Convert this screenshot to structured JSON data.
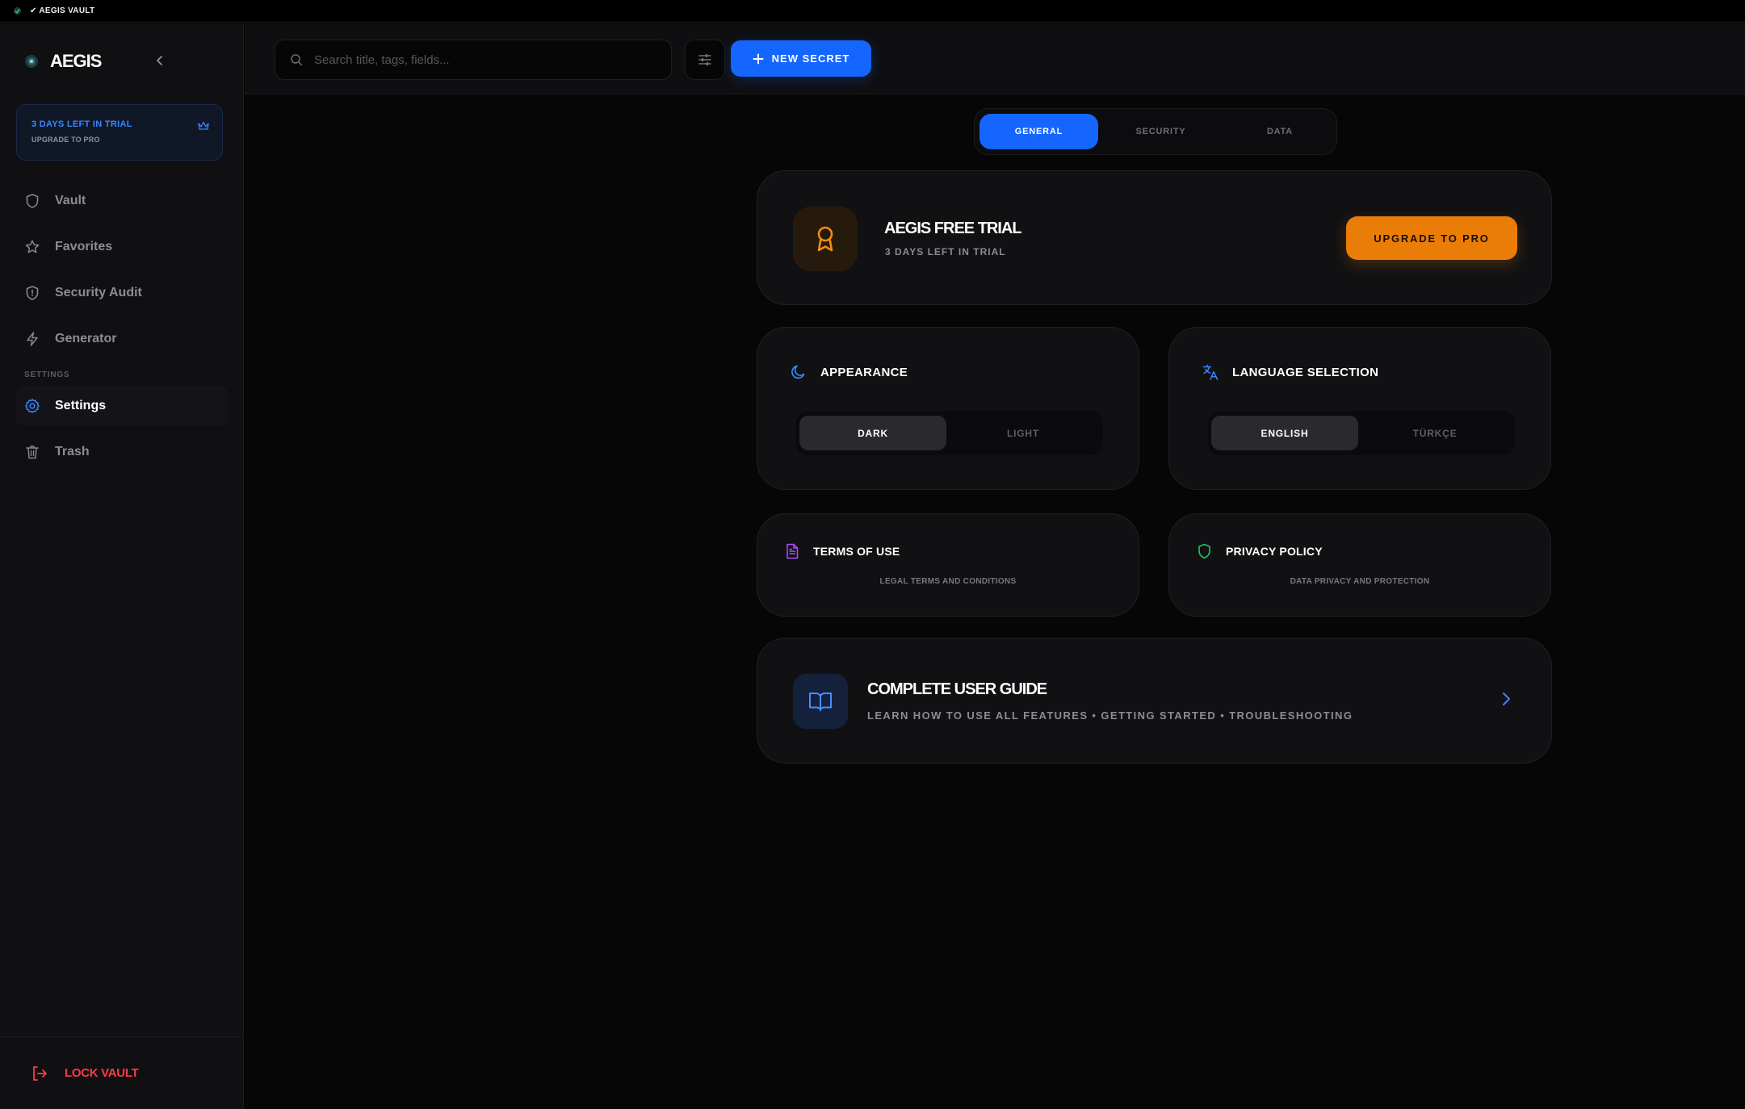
{
  "window": {
    "title": "✔ AEGIS VAULT"
  },
  "sidebar": {
    "brand": "AEGIS",
    "trial": {
      "title": "3 DAYS LEFT IN TRIAL",
      "subtitle": "UPGRADE TO PRO"
    },
    "nav": [
      {
        "label": "Vault",
        "icon": "shield-icon"
      },
      {
        "label": "Favorites",
        "icon": "star-icon"
      },
      {
        "label": "Security Audit",
        "icon": "shield-alert-icon"
      },
      {
        "label": "Generator",
        "icon": "bolt-icon"
      }
    ],
    "section_label": "SETTINGS",
    "settings_nav": [
      {
        "label": "Settings",
        "icon": "gear-icon",
        "active": true
      },
      {
        "label": "Trash",
        "icon": "trash-icon"
      }
    ],
    "lock_label": "LOCK VAULT"
  },
  "topbar": {
    "search_placeholder": "Search title, tags, fields...",
    "new_button": "NEW SECRET"
  },
  "tabs": [
    {
      "label": "GENERAL",
      "active": true
    },
    {
      "label": "SECURITY"
    },
    {
      "label": "DATA"
    }
  ],
  "plan": {
    "title": "AEGIS FREE TRIAL",
    "subtitle": "3 DAYS LEFT IN TRIAL",
    "upgrade_button": "UPGRADE TO PRO"
  },
  "appearance": {
    "title": "APPEARANCE",
    "options": [
      "DARK",
      "LIGHT"
    ],
    "selected": "DARK"
  },
  "language": {
    "title": "LANGUAGE SELECTION",
    "options": [
      "ENGLISH",
      "TÜRKÇE"
    ],
    "selected": "ENGLISH"
  },
  "terms": {
    "title": "TERMS OF USE",
    "subtitle": "LEGAL TERMS AND CONDITIONS"
  },
  "privacy": {
    "title": "PRIVACY POLICY",
    "subtitle": "DATA PRIVACY AND PROTECTION"
  },
  "guide": {
    "title": "COMPLETE USER GUIDE",
    "subtitle": "LEARN HOW TO USE ALL FEATURES • GETTING STARTED • TROUBLESHOOTING"
  },
  "colors": {
    "accent_blue": "#1466ff",
    "accent_orange": "#ea7d08",
    "danger_red": "#ff3b47",
    "terms_purple": "#b04bff",
    "privacy_green": "#22c55e"
  }
}
